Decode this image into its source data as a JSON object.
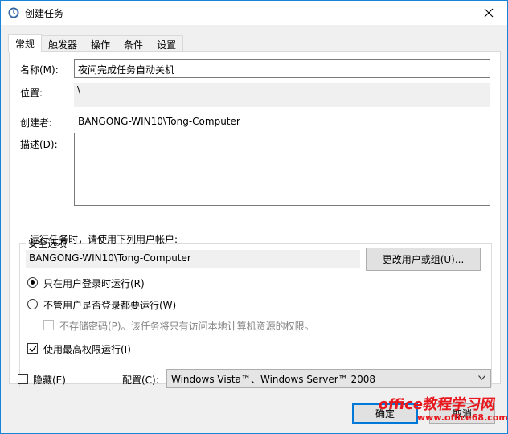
{
  "window": {
    "title": "创建任务"
  },
  "tabs": [
    {
      "label": "常规"
    },
    {
      "label": "触发器"
    },
    {
      "label": "操作"
    },
    {
      "label": "条件"
    },
    {
      "label": "设置"
    }
  ],
  "general": {
    "name_label": "名称(M):",
    "name_value": "夜间完成任务自动关机",
    "location_label": "位置:",
    "location_value": "\\",
    "author_label": "创建者:",
    "author_value": "BANGONG-WIN10\\Tong-Computer",
    "description_label": "描述(D):",
    "description_value": ""
  },
  "security": {
    "group_title": "安全选项",
    "run_as_prompt": "运行任务时，请使用下列用户帐户:",
    "user_account": "BANGONG-WIN10\\Tong-Computer",
    "change_user_button": "更改用户或组(U)...",
    "radio_logged_on": "只在用户登录时运行(R)",
    "radio_logged_on_selected": true,
    "radio_whether_logged": "不管用户是否登录都要运行(W)",
    "radio_whether_logged_selected": false,
    "no_store_password": "不存储密码(P)。该任务将只有访问本地计算机资源的权限。",
    "highest_privileges": "使用最高权限运行(I)",
    "highest_privileges_checked": true
  },
  "footer": {
    "hidden_label": "隐藏(E)",
    "hidden_checked": false,
    "configure_label": "配置(C):",
    "configure_value": "Windows Vista™、Windows Server™ 2008",
    "ok_button": "确定",
    "cancel_button": "取消"
  },
  "watermark": {
    "line1": "office教程学习网",
    "line2": "www.office68.com"
  },
  "colors": {
    "accent": "#0078d7",
    "watermark": "#e8161d"
  }
}
